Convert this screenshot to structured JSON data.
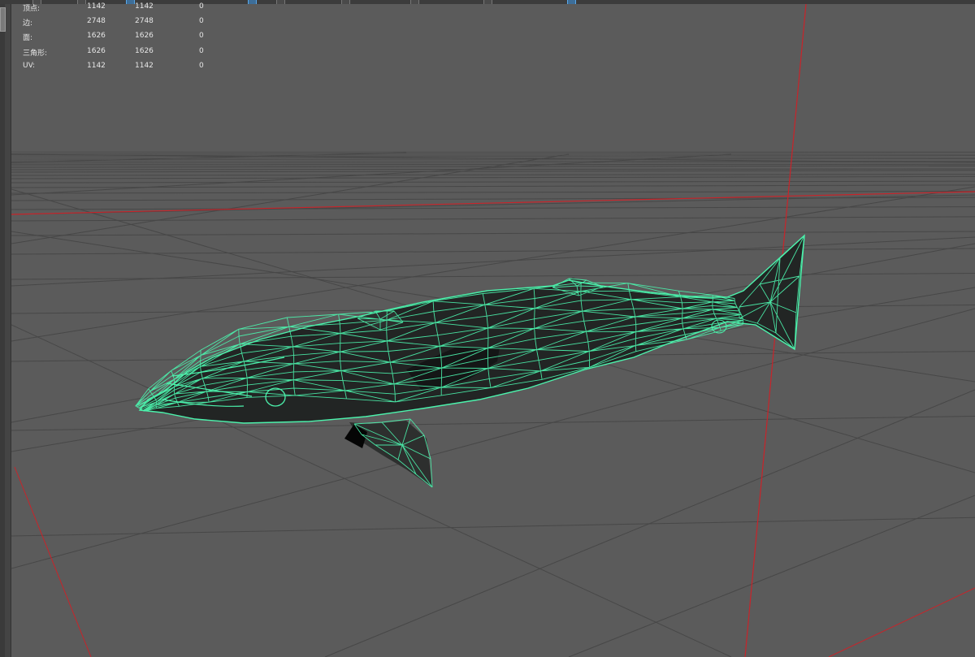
{
  "hud": {
    "rows": [
      {
        "label": "顶点:",
        "object": "1142",
        "selected": "1142",
        "other": "0"
      },
      {
        "label": "边:",
        "object": "2748",
        "selected": "2748",
        "other": "0"
      },
      {
        "label": "面:",
        "object": "1626",
        "selected": "1626",
        "other": "0"
      },
      {
        "label": "三角形:",
        "object": "1626",
        "selected": "1626",
        "other": "0"
      },
      {
        "label": "UV:",
        "object": "1142",
        "selected": "1142",
        "other": "0"
      }
    ]
  },
  "colors": {
    "background": "#5b5b5b",
    "grid": "#474747",
    "axis": "#c8242a",
    "wireframe": "#4cf2ac",
    "selection_accent": "#5aa8e8"
  },
  "icons": [
    "select-tool-icon",
    "snap-icon"
  ]
}
